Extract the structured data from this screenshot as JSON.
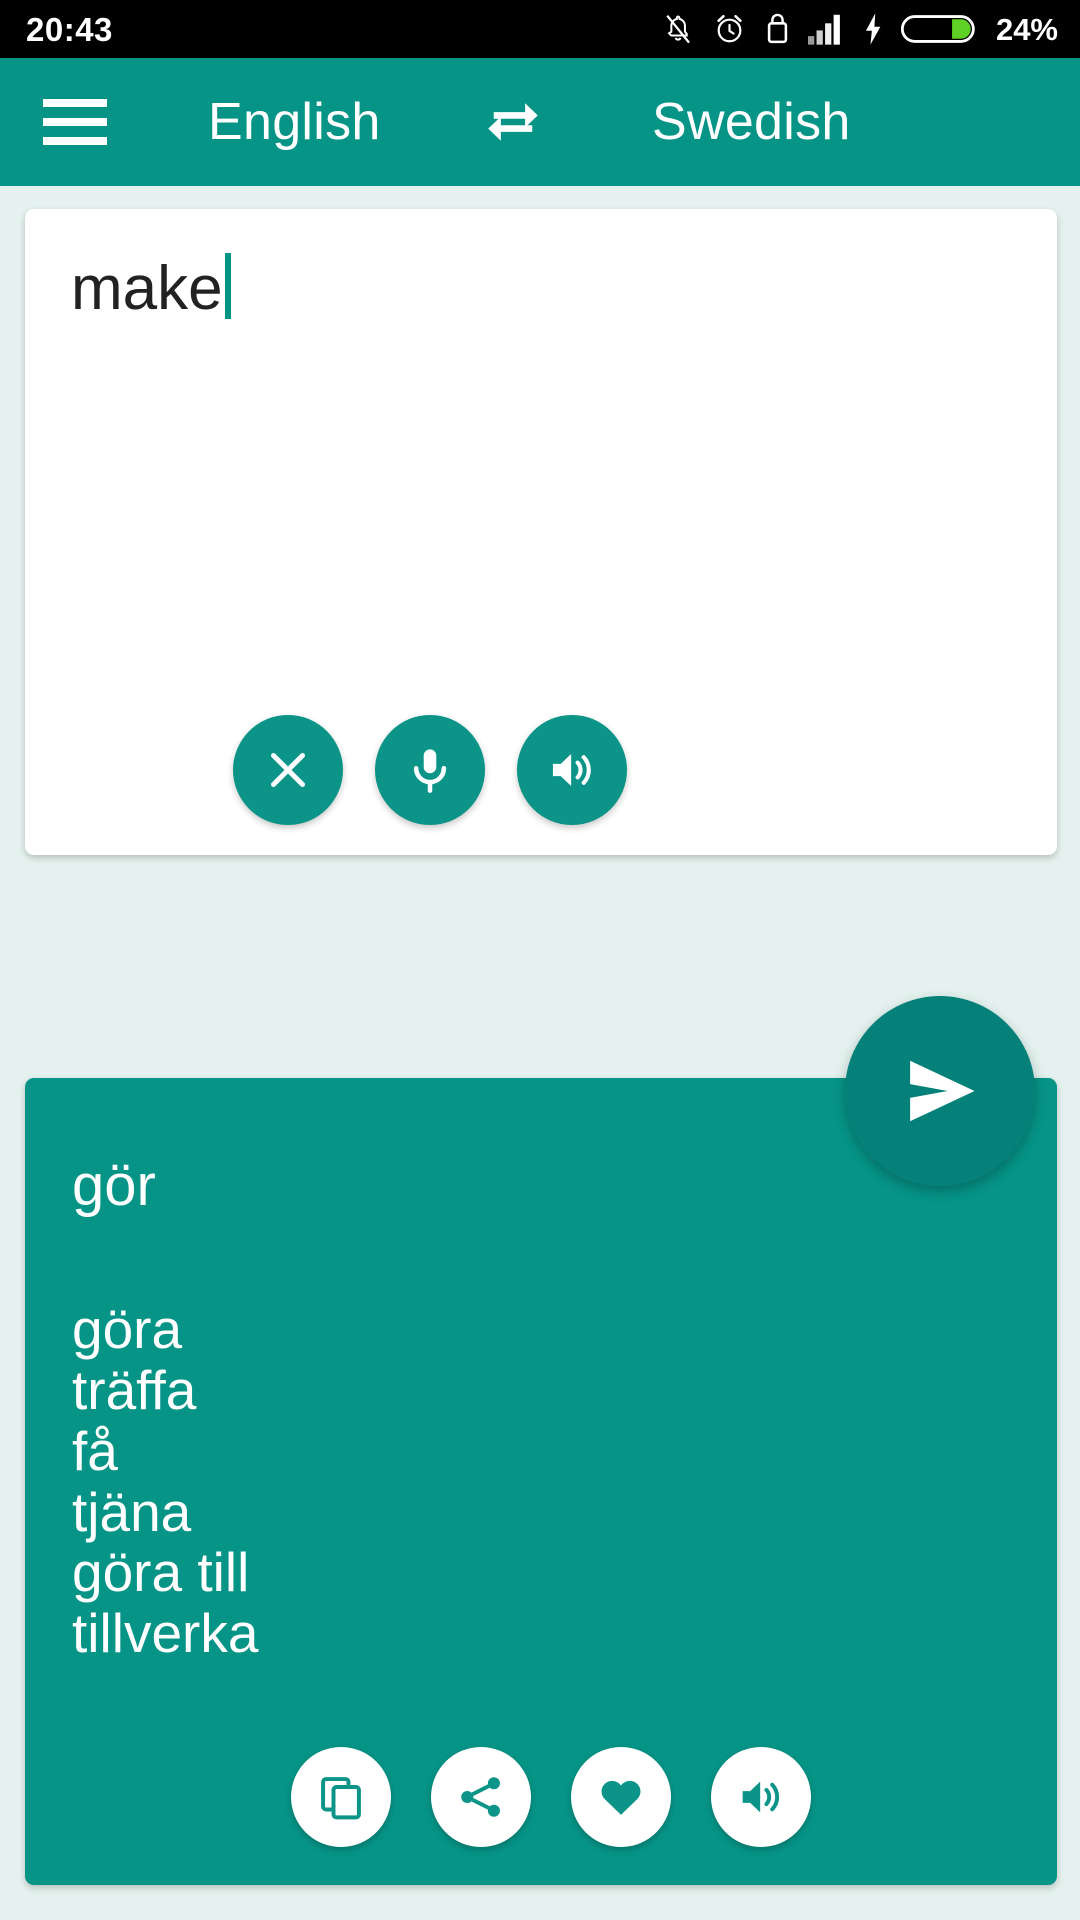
{
  "status_bar": {
    "time": "20:43",
    "battery_percent": "24%",
    "icons": [
      "notifications-off-icon",
      "alarm-icon",
      "usb-lock-icon",
      "signal-bars-icon",
      "charging-bolt-icon",
      "battery-icon"
    ],
    "battery_fill_color": "#5ed124",
    "background_color": "#000000"
  },
  "app_bar": {
    "menu_icon": "hamburger-menu-icon",
    "source_language": "English",
    "swap_icon": "swap-languages-icon",
    "target_language": "Swedish",
    "background_color": "#069487"
  },
  "input_card": {
    "text": "make",
    "placeholder": "",
    "actions": [
      {
        "name": "clear-button",
        "icon": "close-x-icon",
        "label": "Clear"
      },
      {
        "name": "microphone-button",
        "icon": "microphone-icon",
        "label": "Voice input"
      },
      {
        "name": "speak-source-button",
        "icon": "speaker-icon",
        "label": "Listen"
      }
    ],
    "background_color": "#ffffff",
    "text_color": "#222222",
    "caret_color": "#069487"
  },
  "send_button": {
    "icon": "send-arrow-icon",
    "label": "Translate",
    "color": "#05817a"
  },
  "result_card": {
    "primary_translation": "gör",
    "alternatives": [
      "göra",
      "träffa",
      "få",
      "tjäna",
      "göra till",
      "tillverka"
    ],
    "actions": [
      {
        "name": "copy-button",
        "icon": "copy-icon",
        "label": "Copy"
      },
      {
        "name": "share-button",
        "icon": "share-icon",
        "label": "Share"
      },
      {
        "name": "favorite-button",
        "icon": "heart-icon",
        "label": "Favorite"
      },
      {
        "name": "speak-result-button",
        "icon": "speaker-icon",
        "label": "Listen"
      }
    ],
    "background_color": "#069487",
    "text_color": "#ffffff"
  },
  "page": {
    "background_color": "#e4f1ee"
  }
}
